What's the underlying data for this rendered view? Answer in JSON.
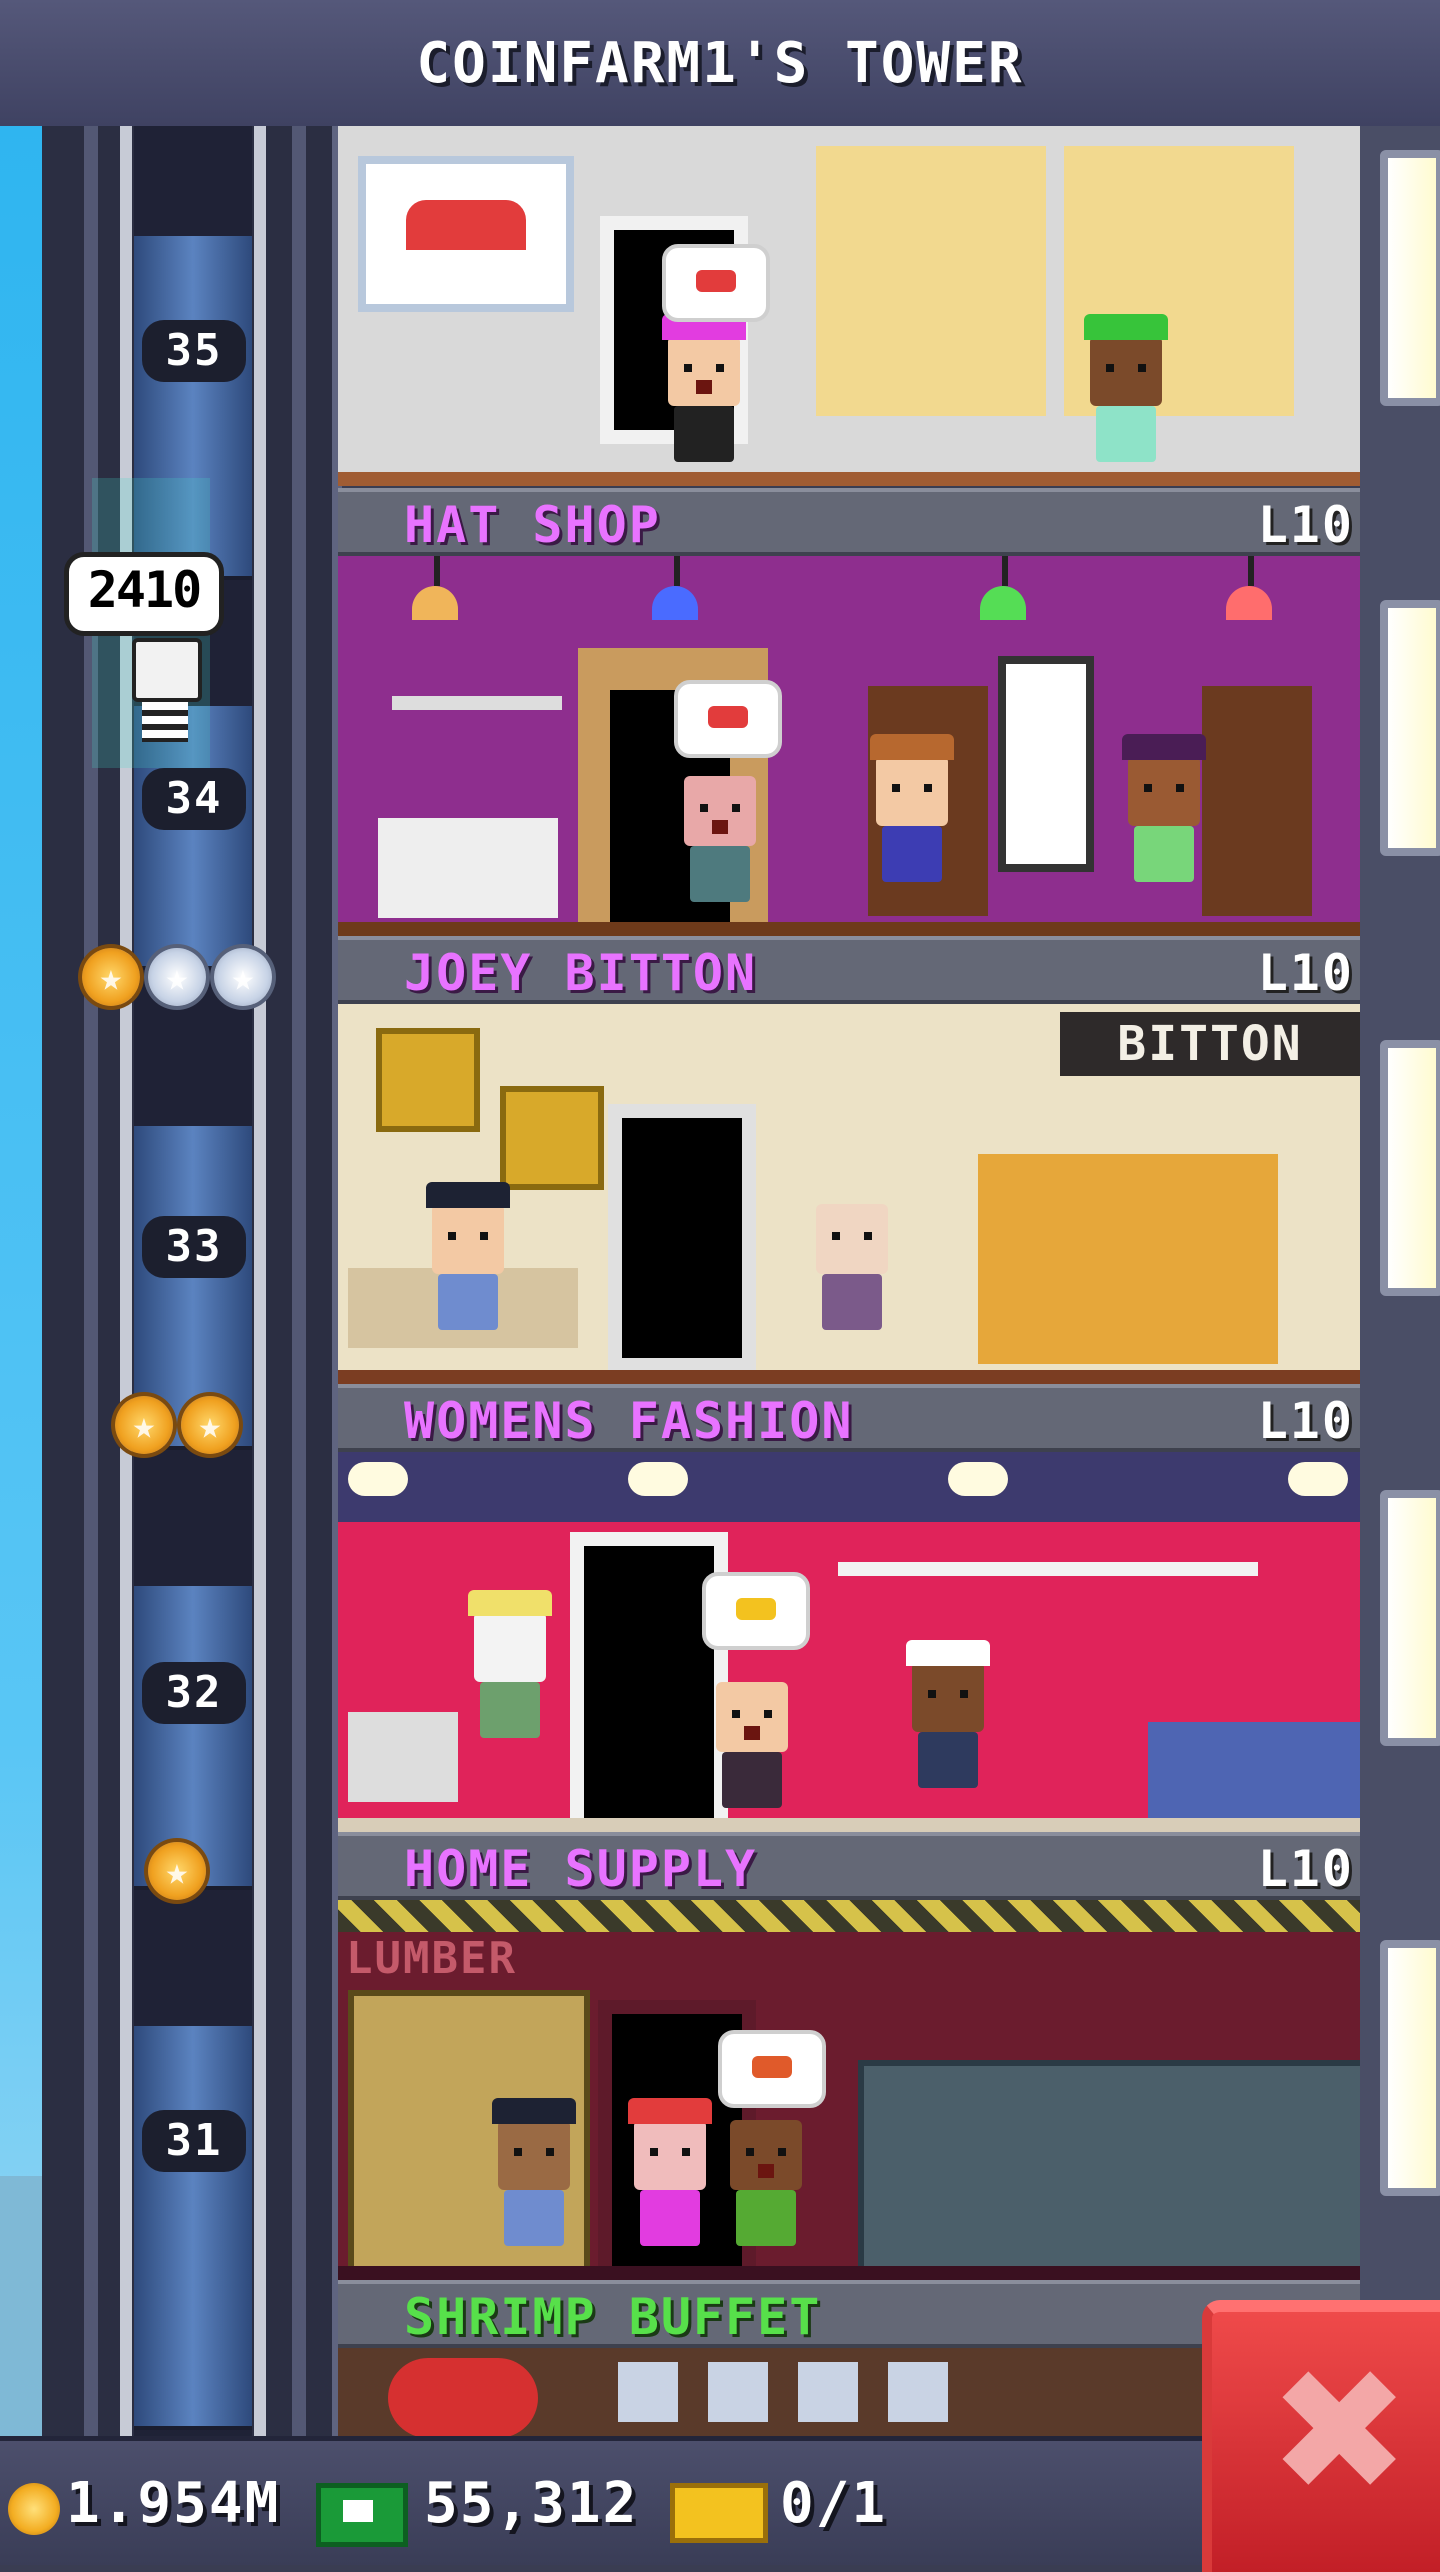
{
  "header": {
    "title": "COINFARM1'S TOWER"
  },
  "elevator": {
    "floor_labels": [
      "35",
      "34",
      "33",
      "32",
      "31"
    ],
    "passenger_bubble": "2410"
  },
  "floors": [
    {
      "name": "HAT SHOP",
      "level": "L10",
      "name_color": "#e873ff",
      "stars_gold": 1,
      "stars_silver": 2
    },
    {
      "name": "JOEY BITTON",
      "level": "L10",
      "name_color": "#e873ff",
      "sign": "BITTON"
    },
    {
      "name": "WOMENS FASHION",
      "level": "L10",
      "name_color": "#e873ff"
    },
    {
      "name": "HOME SUPPLY",
      "level": "L10",
      "name_color": "#e873ff",
      "sign": "LUMBER"
    },
    {
      "name": "SHRIMP BUFFET",
      "level": "",
      "name_color": "#57e04a"
    }
  ],
  "currency": {
    "coins": "1.954M",
    "tower_bux": "55,312",
    "tickets": "0/1"
  },
  "icons": {
    "coin": "coin-icon",
    "bux": "tower-bux-icon",
    "ticket": "golden-ticket-icon",
    "close": "close-icon"
  },
  "colors": {
    "header_bg": "#4a4d6b",
    "close_button": "#d9262e",
    "category_retail": "#e873ff",
    "category_food": "#57e04a"
  }
}
